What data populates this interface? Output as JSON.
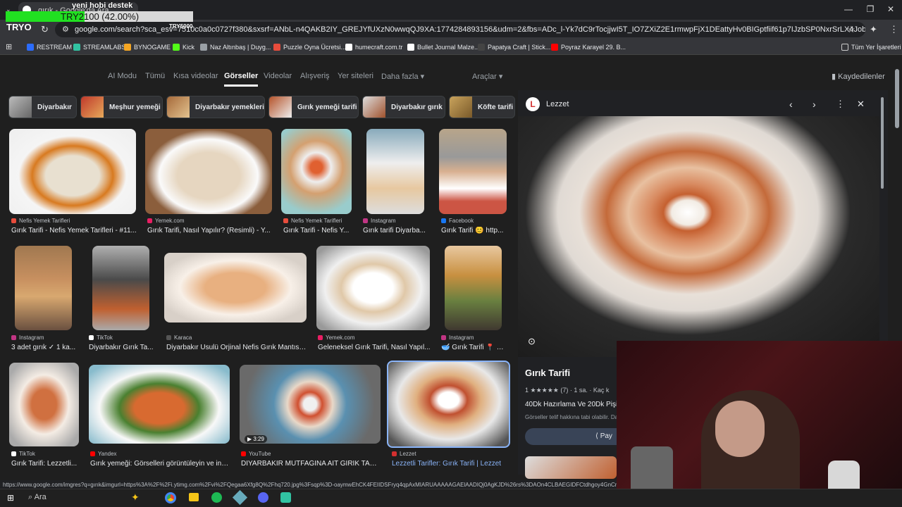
{
  "overlay": {
    "goal_title": "yeni hobi destek",
    "goal_text": "TRY2100 (42.00%)",
    "goal_progress": 0.42,
    "goal_target": "TRY5000",
    "logo": "TRYO"
  },
  "browser": {
    "tab_title": "gırık - Google'da Ara",
    "url": "google.com/search?sca_esv=7510c0a0c0727f380&sxsrf=ANbL-n4QAKB2IY_GREJYfUXzN0wwqQJ9XA:1774284893156&udm=2&fbs=ADc_l-Yk7dC9rTocjjwI5T_IO7ZXiZ2E1rmwpFjX1DEattyHv0BIGptfiif61p7IJzbSP0NxrSrLX4Jobfnc8Mt3t4Xqj7l8OG35V8x-QabEXjdU2_al...",
    "bookmarks": [
      "RESTREAM",
      "STREAMLABS",
      "BYNOGAME",
      "Kick",
      "Naz Altınbaş | Duyg...",
      "Puzzle Oyna Ücretsi...",
      "humecraft.com.tr",
      "Bullet Journal Malze...",
      "Papatya Craft | Stick...",
      "Poyraz Karayel 29. B..."
    ],
    "all_bookmarks": "Tüm Yer İşaretleri",
    "status_url": "https://www.google.com/imgres?q=gırık&imgurl=https%3A%2F%2Fi.ytimg.com%2Fvi%2FQegaa6Xfg8Q%2Fhq720.jpg%3Fsqp%3D-oaymwEhCK4FEIIDSFryq4qpAxMIARUAAAAAGAElAADIQj0AgKJD%26rs%3DAOn4CLBAEGIDFCtdhgoy4GnCn12YH6z"
  },
  "google": {
    "tabs": [
      "AI Modu",
      "Tümü",
      "Kısa videolar",
      "Görseller",
      "Videolar",
      "Alışveriş",
      "Yer siteleri",
      "Daha fazla",
      "Araçlar"
    ],
    "active_tab": "Görseller",
    "saved": "Kaydedilenler",
    "chips": [
      "Diyarbakır",
      "Meşhur yemeği",
      "Diyarbakır yemekleri",
      "Gırık yemeği tarifi",
      "Diyarbakır gırık",
      "Köfte tarifi"
    ],
    "results": [
      {
        "source": "Nefis Yemek Tarifleri",
        "caption": "Gırık Tarifi - Nefis Yemek Tarifleri - #11...",
        "color": "#e74c3c"
      },
      {
        "source": "Yemek.com",
        "caption": "Gırık Tarifi, Nasıl Yapılır? (Resimli) - Y...",
        "color": "#e91e63"
      },
      {
        "source": "Nefis Yemek Tarifleri",
        "caption": "Gırık Tarifi - Nefis Y...",
        "color": "#e74c3c"
      },
      {
        "source": "Instagram",
        "caption": "Gırık tarifi Diyarba...",
        "color": "#c13584"
      },
      {
        "source": "Facebook",
        "caption": "Gırık Tarifi 😊 http...",
        "color": "#1877f2"
      },
      {
        "source": "Instagram",
        "caption": "3 adet gırık ✓ 1 ka...",
        "color": "#c13584"
      },
      {
        "source": "TikTok",
        "caption": "Diyarbakır Gırık Ta...",
        "color": "#ffffff"
      },
      {
        "source": "Karaca",
        "caption": "Diyarbakır Usulü Orjinal Nefis Gırık Mantısı ...",
        "color": "#555555"
      },
      {
        "source": "Yemek.com",
        "caption": "Geleneksel Gırık Tarifi, Nasıl Yapıl...",
        "color": "#e91e63"
      },
      {
        "source": "Instagram",
        "caption": "🥣 Gırık Tarifi 📍 Di...",
        "color": "#c13584"
      },
      {
        "source": "TikTok",
        "caption": "Gırık Tarifi: Lezzetli...",
        "color": "#ffffff"
      },
      {
        "source": "Yandex",
        "caption": "Gırık yemeği: Görselleri görüntüleyin ve ind...",
        "color": "#ff0000"
      },
      {
        "source": "YouTube",
        "caption": "DİYARBAKIR MUTFAĞINA AİT GIRIK TARİ...",
        "color": "#ff0000",
        "duration": "3:29"
      },
      {
        "source": "Lezzet",
        "caption": "Lezzetli Tarifler: Gırık Tarifi | Lezzet",
        "color": "#d32f2f"
      }
    ],
    "panel": {
      "site": "Lezzet",
      "title": "Gırık Tarifi",
      "rating": "1 ★★★★★ (7) · 1 sa. · Kaç k",
      "desc": "40Dk Hazırlama Ve 20Dk Pişim",
      "copyright": "Görseller telif hakkına tabi olabilir. Da",
      "share": "Pay"
    }
  },
  "taskbar": {
    "search": "Ara"
  }
}
